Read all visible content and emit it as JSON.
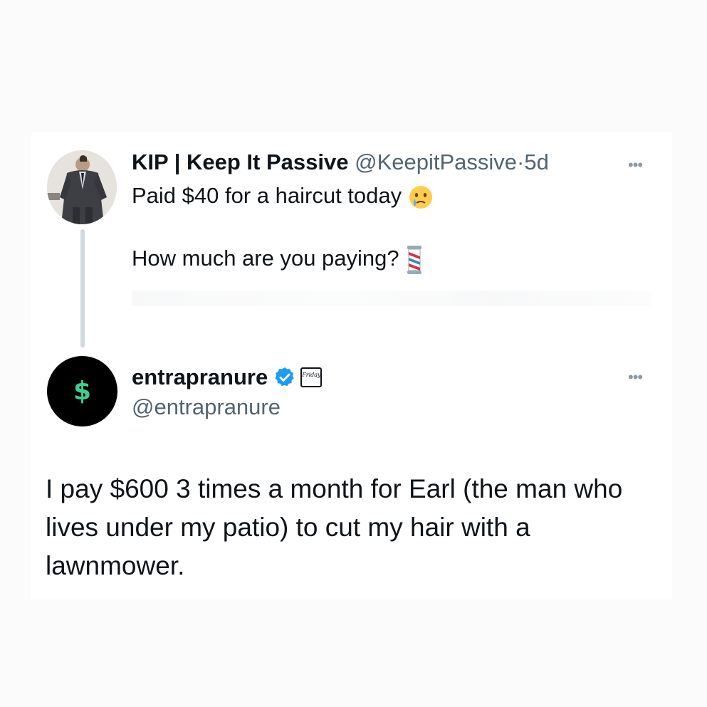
{
  "original_tweet": {
    "display_name": "KIP | Keep It Passive",
    "handle": "@KeepitPassive",
    "separator": "·",
    "time": "5d",
    "line1": "Paid $40 for a haircut today",
    "line1_emoji": "face-holding-back-tears",
    "line2": "How much are you paying?",
    "line2_emoji": "barber-pole",
    "more_label": "•••"
  },
  "reply_tweet": {
    "display_name": "entrapranure",
    "handle": "@entrapranure",
    "verified": true,
    "affiliate_badge_text": "Friday",
    "avatar_symbol": "$",
    "more_label": "•••",
    "body": "I pay $600 3 times a month for Earl (the man who lives under my patio) to cut my hair with a lawnmower."
  },
  "colors": {
    "verified_blue": "#1d9bf0",
    "dollar_green": "#3ecf8e",
    "muted_text": "#536471",
    "thread_line": "#cfd9de"
  }
}
